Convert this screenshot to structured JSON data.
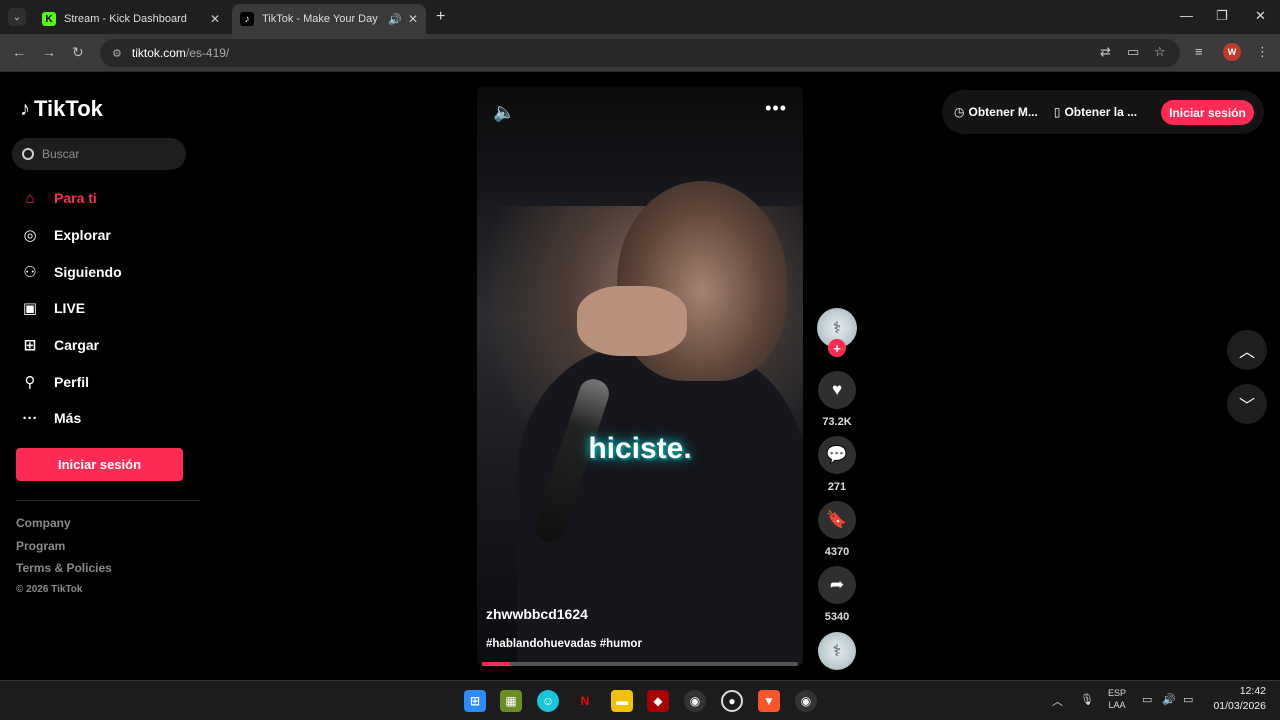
{
  "browser": {
    "tabs": [
      {
        "title": "Stream - Kick Dashboard",
        "favicon": "K"
      },
      {
        "title": "TikTok - Make Your Day",
        "favicon": "♪"
      }
    ],
    "url_host": "tiktok.com",
    "url_path": "/es-419/",
    "profile_initial": "W"
  },
  "sidebar": {
    "logo": "TikTok",
    "search_placeholder": "Buscar",
    "items": [
      {
        "label": "Para ti",
        "icon": "home-icon"
      },
      {
        "label": "Explorar",
        "icon": "compass-icon"
      },
      {
        "label": "Siguiendo",
        "icon": "following-icon"
      },
      {
        "label": "LIVE",
        "icon": "live-icon"
      },
      {
        "label": "Cargar",
        "icon": "upload-icon"
      },
      {
        "label": "Perfil",
        "icon": "profile-icon"
      },
      {
        "label": "Más",
        "icon": "more-icon"
      }
    ],
    "login_label": "Iniciar sesión",
    "footer": {
      "company": "Company",
      "program": "Program",
      "terms": "Terms & Policies",
      "copyright": "© 2026 TikTok"
    }
  },
  "video": {
    "caption": "hiciste.",
    "username": "zhwwbbcd1624",
    "hashtags": "#hablandohuevadas #humor",
    "progress": 0.09
  },
  "actions": {
    "likes": "73.2K",
    "comments": "271",
    "saves": "4370",
    "shares": "5340"
  },
  "topbar": {
    "get_coins": "Obtener M...",
    "get_app": "Obtener la ...",
    "login_label": "Iniciar sesión"
  },
  "taskbar": {
    "lang1": "ESP",
    "lang2": "LAA",
    "time": "12:42",
    "date": "01/03/2026"
  },
  "colors": {
    "accent": "#fe2c55",
    "background": "#000000"
  }
}
